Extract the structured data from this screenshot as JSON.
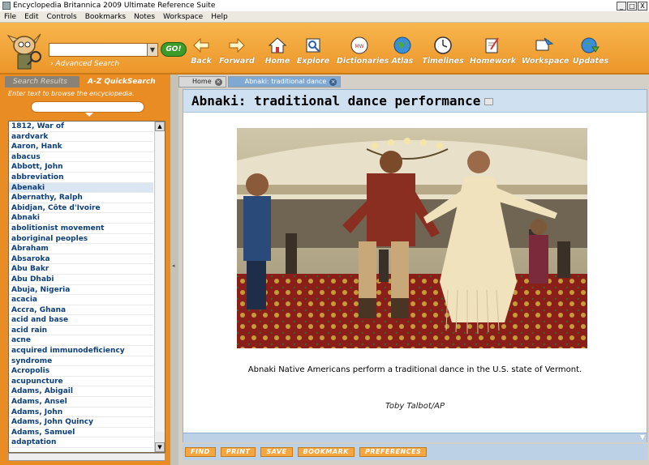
{
  "window": {
    "title": "Encyclopedia Britannica 2009 Ultimate Reference Suite",
    "buttons": [
      "_",
      "□",
      "X"
    ]
  },
  "menu": [
    "File",
    "Edit",
    "Controls",
    "Bookmarks",
    "Notes",
    "Workspace",
    "Help"
  ],
  "toolbar": {
    "search_placeholder": "",
    "go_label": "GO!",
    "advanced_search": "› Advanced Search",
    "buttons": [
      {
        "label": "Back",
        "icon": "back-arrow-icon"
      },
      {
        "label": "Forward",
        "icon": "forward-arrow-icon"
      },
      {
        "label": "Home",
        "icon": "home-icon"
      },
      {
        "label": "Explore",
        "icon": "explore-icon"
      },
      {
        "label": "Dictionaries",
        "icon": "dictionaries-icon"
      },
      {
        "label": "Atlas",
        "icon": "globe-icon"
      },
      {
        "label": "Timelines",
        "icon": "clock-icon"
      },
      {
        "label": "Homework",
        "icon": "homework-icon"
      },
      {
        "label": "Workspace",
        "icon": "workspace-icon"
      },
      {
        "label": "Updates",
        "icon": "updates-icon"
      }
    ]
  },
  "left_panel": {
    "tabs": [
      "Search Results",
      "A-Z QuickSearch"
    ],
    "active_tab": "A-Z QuickSearch",
    "hint": "Enter text to browse the encyclopedia.",
    "items": [
      "1812, War of",
      "aardvark",
      "Aaron, Hank",
      "abacus",
      "Abbott, John",
      "abbreviation",
      "Abenaki",
      "Abernathy, Ralph",
      "Abidjan, Côte d'Ivoire",
      "Abnaki",
      "abolitionist movement",
      "aboriginal peoples",
      "Abraham",
      "Absaroka",
      "Abu Bakr",
      "Abu Dhabi",
      "Abuja, Nigeria",
      "acacia",
      "Accra, Ghana",
      "acid and base",
      "acid rain",
      "acne",
      "acquired immunodeficiency",
      "syndrome",
      "Acropolis",
      "acupuncture",
      "Adams, Abigail",
      "Adams, Ansel",
      "Adams, John",
      "Adams, John Quincy",
      "Adams, Samuel",
      "adaptation"
    ],
    "selected_item": "Abenaki"
  },
  "tabs": [
    {
      "label": "Home"
    },
    {
      "label": "Abnaki: traditional dance"
    }
  ],
  "article": {
    "title": "Abnaki: traditional dance performance",
    "caption": "Abnaki Native Americans perform a traditional dance in the U.S. state of Vermont.",
    "credit": "Toby Talbot/AP"
  },
  "bottom_buttons": [
    "FIND",
    "PRINT",
    "SAVE",
    "BOOKMARK",
    "PREFERENCES"
  ]
}
